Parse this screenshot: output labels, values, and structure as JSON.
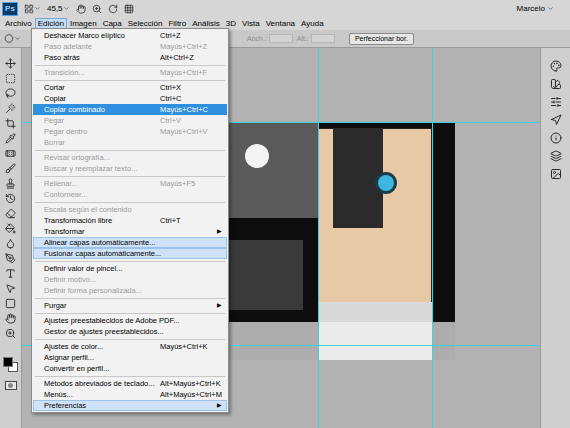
{
  "app": {
    "logo": "Ps",
    "zoom": "45,5",
    "user": "Marcelo"
  },
  "menubar": [
    {
      "label": "Archivo",
      "selected": false
    },
    {
      "label": "Edición",
      "selected": true
    },
    {
      "label": "Imagen",
      "selected": false
    },
    {
      "label": "Capa",
      "selected": false
    },
    {
      "label": "Selección",
      "selected": false
    },
    {
      "label": "Filtro",
      "selected": false
    },
    {
      "label": "Análisis",
      "selected": false
    },
    {
      "label": "3D",
      "selected": false
    },
    {
      "label": "Vista",
      "selected": false
    },
    {
      "label": "Ventana",
      "selected": false
    },
    {
      "label": "Ayuda",
      "selected": false
    }
  ],
  "options_bar": {
    "fields": [
      {
        "label": "Anch.:",
        "disabled": true
      },
      {
        "label": "Alt.:",
        "disabled": true
      }
    ],
    "button": "Perfeccionar bor."
  },
  "menu": [
    {
      "kind": "item",
      "label": "Deshacer Marco elíptico",
      "shortcut": "Ctrl+Z",
      "disabled": false,
      "highlighted": false,
      "selected": false
    },
    {
      "kind": "item",
      "label": "Paso adelante",
      "shortcut": "Mayús+Ctrl+Z",
      "disabled": true,
      "highlighted": false,
      "selected": false
    },
    {
      "kind": "item",
      "label": "Paso atrás",
      "shortcut": "Alt+Ctrl+Z",
      "disabled": false,
      "highlighted": false,
      "selected": false
    },
    {
      "kind": "separator"
    },
    {
      "kind": "item",
      "label": "Transición...",
      "shortcut": "Mayús+Ctrl+F",
      "disabled": true,
      "highlighted": false,
      "selected": false
    },
    {
      "kind": "separator"
    },
    {
      "kind": "item",
      "label": "Cortar",
      "shortcut": "Ctrl+X",
      "disabled": false,
      "highlighted": false,
      "selected": false
    },
    {
      "kind": "item",
      "label": "Copiar",
      "shortcut": "Ctrl+C",
      "disabled": false,
      "highlighted": false,
      "selected": false
    },
    {
      "kind": "item",
      "label": "Copiar combinado",
      "shortcut": "Mayús+Ctrl+C",
      "disabled": false,
      "highlighted": false,
      "selected": true
    },
    {
      "kind": "item",
      "label": "Pegar",
      "shortcut": "Ctrl+V",
      "disabled": true,
      "highlighted": false,
      "selected": false
    },
    {
      "kind": "item",
      "label": "Pegar dentro",
      "shortcut": "Mayús+Ctrl+V",
      "disabled": true,
      "highlighted": false,
      "selected": false
    },
    {
      "kind": "item",
      "label": "Borrar",
      "disabled": true,
      "highlighted": false,
      "selected": false
    },
    {
      "kind": "separator"
    },
    {
      "kind": "item",
      "label": "Revisar ortografía...",
      "disabled": true,
      "highlighted": false,
      "selected": false
    },
    {
      "kind": "item",
      "label": "Buscar y reemplazar texto...",
      "disabled": true,
      "highlighted": false,
      "selected": false
    },
    {
      "kind": "separator"
    },
    {
      "kind": "item",
      "label": "Rellenar...",
      "shortcut": "Mayús+F5",
      "disabled": true,
      "highlighted": false,
      "selected": false
    },
    {
      "kind": "item",
      "label": "Contornear...",
      "disabled": true,
      "highlighted": false,
      "selected": false
    },
    {
      "kind": "separator"
    },
    {
      "kind": "item",
      "label": "Escala según el contenido",
      "disabled": true,
      "highlighted": false,
      "selected": false
    },
    {
      "kind": "item",
      "label": "Transformación libre",
      "shortcut": "Ctrl+T",
      "disabled": false,
      "highlighted": false,
      "selected": false
    },
    {
      "kind": "item",
      "label": "Transformar",
      "arrow": "▶",
      "disabled": false,
      "highlighted": false,
      "selected": false
    },
    {
      "kind": "item",
      "label": "Alinear capas automáticamente...",
      "disabled": false,
      "highlighted": true,
      "selected": false
    },
    {
      "kind": "item",
      "label": "Fusionar capas automáticamente...",
      "disabled": false,
      "highlighted": true,
      "selected": false
    },
    {
      "kind": "separator"
    },
    {
      "kind": "item",
      "label": "Definir valor de pincel...",
      "disabled": false,
      "highlighted": false,
      "selected": false
    },
    {
      "kind": "item",
      "label": "Definir motivo...",
      "disabled": true,
      "highlighted": false,
      "selected": false
    },
    {
      "kind": "item",
      "label": "Definir forma personalizada...",
      "disabled": true,
      "highlighted": false,
      "selected": false
    },
    {
      "kind": "separator"
    },
    {
      "kind": "item",
      "label": "Purgar",
      "arrow": "▶",
      "disabled": false,
      "highlighted": false,
      "selected": false
    },
    {
      "kind": "separator"
    },
    {
      "kind": "item",
      "label": "Ajustes preestablecidos de Adobe PDF...",
      "disabled": false,
      "highlighted": false,
      "selected": false
    },
    {
      "kind": "item",
      "label": "Gestor de ajustes preestablecidos...",
      "disabled": false,
      "highlighted": false,
      "selected": false
    },
    {
      "kind": "separator"
    },
    {
      "kind": "item",
      "label": "Ajustes de color...",
      "shortcut": "Mayús+Ctrl+K",
      "disabled": false,
      "highlighted": false,
      "selected": false
    },
    {
      "kind": "item",
      "label": "Asignar perfil...",
      "disabled": false,
      "highlighted": false,
      "selected": false
    },
    {
      "kind": "item",
      "label": "Convertir en perfil...",
      "disabled": false,
      "highlighted": false,
      "selected": false
    },
    {
      "kind": "separator"
    },
    {
      "kind": "item",
      "label": "Métodos abreviados de teclado...",
      "shortcut": "Alt+Mayús+Ctrl+K",
      "disabled": false,
      "highlighted": false,
      "selected": false
    },
    {
      "kind": "item",
      "label": "Menús...",
      "shortcut": "Alt+Mayús+Ctrl+M",
      "disabled": false,
      "highlighted": false,
      "selected": false
    },
    {
      "kind": "item",
      "label": "Preferencias",
      "arrow": "▶",
      "disabled": false,
      "highlighted": true,
      "selected": false
    }
  ]
}
